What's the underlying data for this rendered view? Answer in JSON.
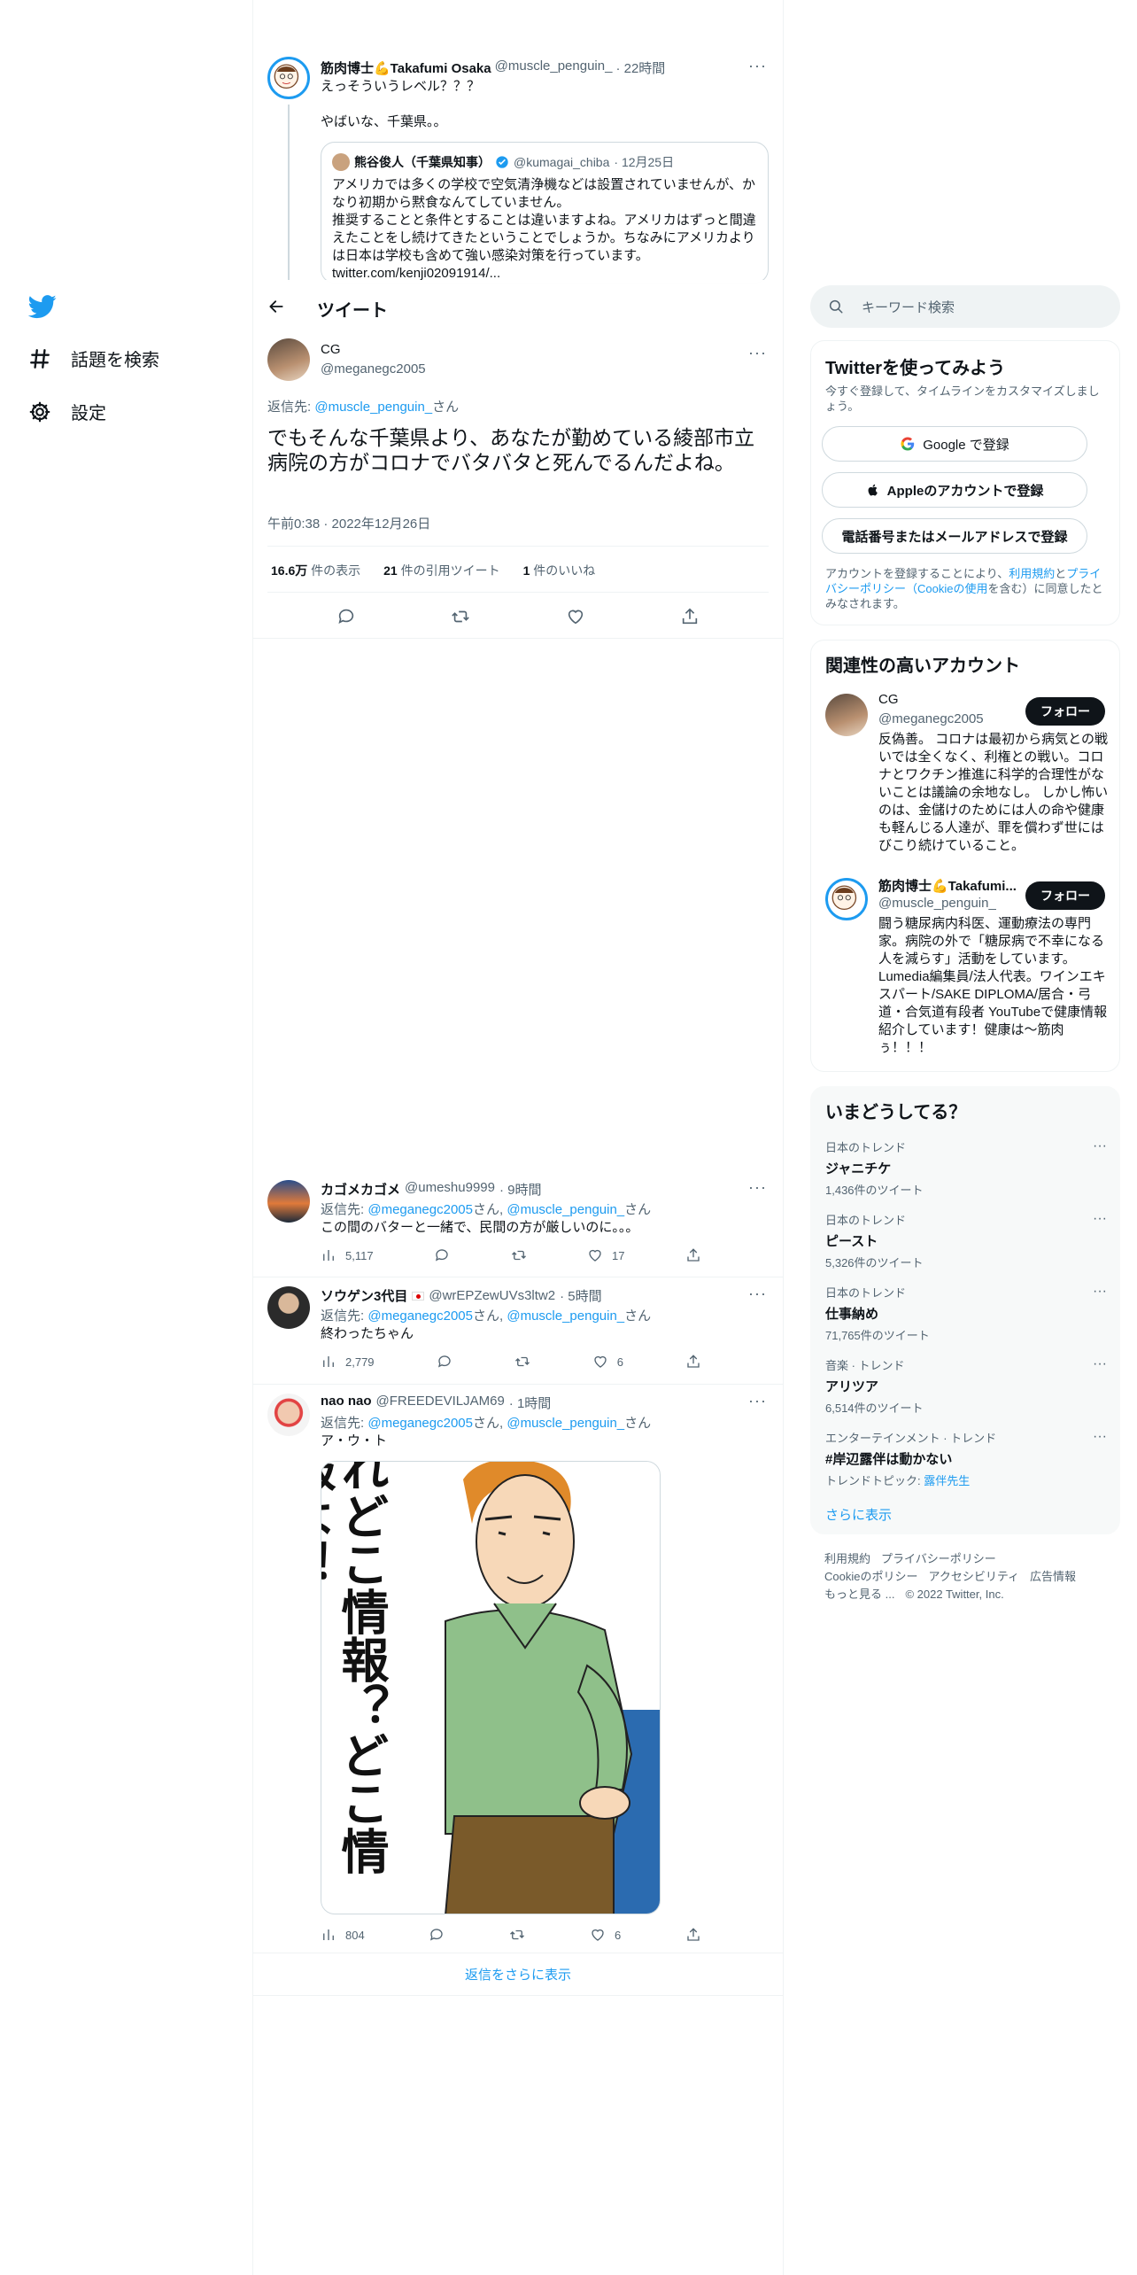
{
  "nav": {
    "logo": "twitter-bird-icon",
    "explore_label": "話題を検索",
    "settings_label": "設定"
  },
  "header": {
    "title": "ツイート"
  },
  "parent_tweet": {
    "name": "筋肉博士💪Takafumi Osaka",
    "handle": "@muscle_penguin_",
    "time": "· 22時間",
    "line1": "えっそういうレベル？？？",
    "line2": "やばいな、千葉県。。",
    "quote": {
      "name": "熊谷俊人（千葉県知事）",
      "handle": "@kumagai_chiba",
      "time": "· 12月25日",
      "text1": "アメリカでは多くの学校で空気清浄機などは設置されていませんが、かなり初期から黙食なんてしていません。",
      "text2": "推奨することと条件とすることは違いますよね。アメリカはずっと間違えたことをし続けてきたということでしょうか。ちなみにアメリカよりは日本は学校も含めて強い感染対策を行っています。",
      "link": "twitter.com/kenji02091914/..."
    }
  },
  "main_tweet": {
    "name": "CG",
    "handle": "@meganegc2005",
    "reply_prefix": "返信先:",
    "reply_to": "@muscle_penguin_",
    "reply_suffix": "さん",
    "text": "でもそんな千葉県より、あなたが勤めている綾部市立病院の方がコロナでバタバタと死んでるんだよね。",
    "timestamp": "午前0:38 · 2022年12月26日",
    "views_num": "16.6万",
    "views_label": "件の表示",
    "quotes_num": "21",
    "quotes_label": "件の引用ツイート",
    "likes_num": "1",
    "likes_label": "件のいいね"
  },
  "replies": [
    {
      "name": "カゴメカゴメ",
      "handle": "@umeshu9999",
      "time": "· 9時間",
      "reply_prefix": "返信先:",
      "to1": "@meganegc2005",
      "mid": "さん,",
      "to2": "@muscle_penguin_",
      "suffix": "さん",
      "text": "この間のバターと一緒で、民間の方が厳しいのに。。。",
      "views": "5,117",
      "likes": "17"
    },
    {
      "name": "ソウゲン3代目",
      "handle": "@wrEPZewUVs3ltw2",
      "time": "· 5時間",
      "reply_prefix": "返信先:",
      "to1": "@meganegc2005",
      "mid": "さん,",
      "to2": "@muscle_penguin_",
      "suffix": "さん",
      "text": "終わったちゃん",
      "views": "2,779",
      "likes": "6"
    },
    {
      "name": "nao nao",
      "handle": "@FREEDEVILJAM69",
      "time": "· 1時間",
      "reply_prefix": "返信先:",
      "to1": "@meganegc2005",
      "mid": "さん,",
      "to2": "@muscle_penguin_",
      "suffix": "さん",
      "text": "ア・ウ・ト",
      "image_text": "れどこ情報？どこ情報よ！",
      "views": "804",
      "likes": "6"
    }
  ],
  "show_more_replies": "返信をさらに表示",
  "search": {
    "placeholder": "キーワード検索"
  },
  "signup": {
    "title": "Twitterを使ってみよう",
    "subtitle": "今すぐ登録して、タイムラインをカスタマイズしましょう。",
    "google": "Google で登録",
    "apple": "Appleのアカウントで登録",
    "phone": "電話番号またはメールアドレスで登録",
    "terms_pre": "アカウントを登録することにより、",
    "terms_link1": "利用規約",
    "terms_and": "と",
    "terms_link2": "プライバシーポリシー（Cookieの使用",
    "terms_post": "を含む）に同意したとみなされます。"
  },
  "related": {
    "title": "関連性の高いアカウント",
    "follow_label": "フォロー",
    "accounts": [
      {
        "name": "CG",
        "handle": "@meganegc2005",
        "bio": "反偽善。 コロナは最初から病気との戦いでは全くなく、利権との戦い。コロナとワクチン推進に科学的合理性がないことは議論の余地なし。 しかし怖いのは、金儲けのためには人の命や健康も軽んじる人達が、罪を償わず世にはびこり続けていること。"
      },
      {
        "name": "筋肉博士💪Takafumi...",
        "handle": "@muscle_penguin_",
        "bio": "闘う糖尿病内科医、運動療法の専門家。病院の外で「糖尿病で不幸になる人を減らす」活動をしています。Lumedia編集員/法人代表。ワインエキスパート/SAKE DIPLOMA/居合・弓道・合気道有段者 YouTubeで健康情報紹介しています！健康は～筋肉ぅ！！！"
      }
    ]
  },
  "trends": {
    "title": "いまどうしてる？",
    "items": [
      {
        "category": "日本のトレンド",
        "name": "ジャニチケ",
        "count": "1,436件のツイート"
      },
      {
        "category": "日本のトレンド",
        "name": "ピースト",
        "count": "5,326件のツイート"
      },
      {
        "category": "日本のトレンド",
        "name": "仕事納め",
        "count": "71,765件のツイート"
      },
      {
        "category": "音楽 · トレンド",
        "name": "アリツア",
        "count": "6,514件のツイート"
      },
      {
        "category": "エンターテインメント · トレンド",
        "name": "#岸辺露伴は動かない",
        "count_prefix": "トレンドトピック:",
        "count_link": "露伴先生"
      }
    ],
    "show_more": "さらに表示"
  },
  "footer": {
    "terms": "利用規約",
    "privacy": "プライバシーポリシー",
    "cookie": "Cookieのポリシー",
    "accessibility": "アクセシビリティ",
    "ads": "広告情報",
    "more": "もっと見る ...",
    "copyright": "© 2022 Twitter, Inc."
  },
  "colors": {
    "accent": "#1d9bf0",
    "text": "#0f1419",
    "muted": "#536471",
    "border": "#eff3f4"
  }
}
